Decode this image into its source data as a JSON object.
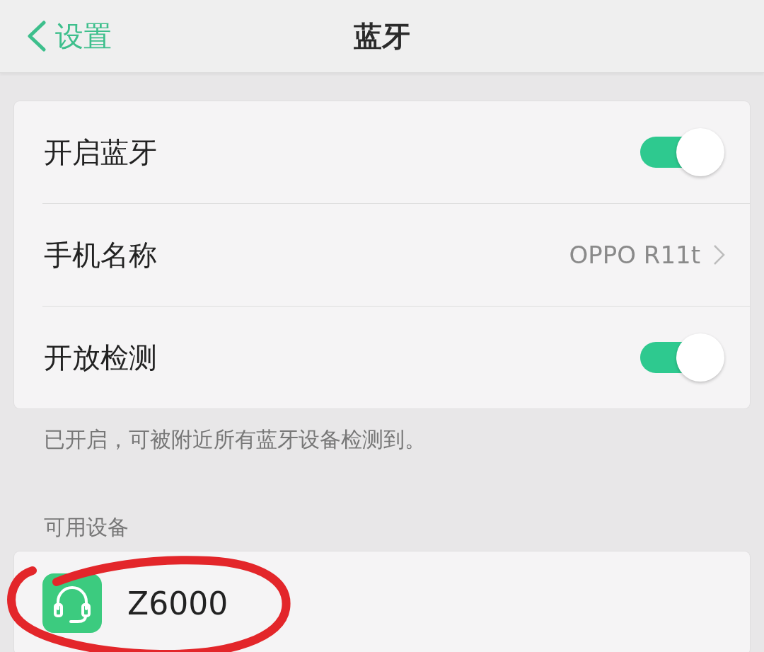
{
  "header": {
    "back_label": "设置",
    "title": "蓝牙"
  },
  "settings": [
    {
      "kind": "toggle",
      "label": "开启蓝牙",
      "on": true
    },
    {
      "kind": "value",
      "label": "手机名称",
      "value": "OPPO R11t"
    },
    {
      "kind": "toggle",
      "label": "开放检测",
      "on": true
    }
  ],
  "caption": "已开启，可被附近所有蓝牙设备检测到。",
  "section_title": "可用设备",
  "devices": [
    {
      "kind": "headset",
      "name": "Z6000",
      "circled": true
    }
  ]
}
